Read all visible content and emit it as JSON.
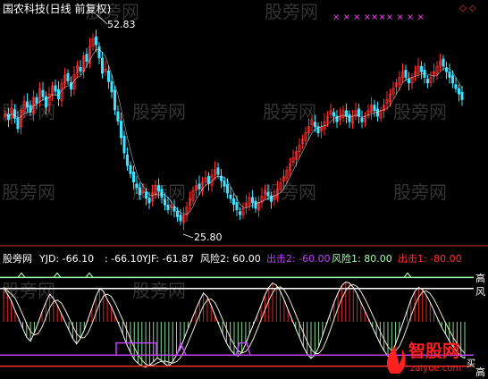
{
  "header": {
    "stock_title": "国农科技(日线 前复权)"
  },
  "price_panel": {
    "high_label": "52.83",
    "low_label": "25.80",
    "top_markers": "× × × ×××× × × ×",
    "right_marker": "◇ ◇",
    "watermarks": [
      "股旁网",
      "股旁网",
      "股旁网",
      "股旁网",
      "股旁网",
      "股旁网",
      "股旁网",
      "股旁网",
      "股旁网",
      "股旁网",
      "股旁网",
      "股旁网"
    ]
  },
  "indicator_panel": {
    "name": "股旁网",
    "legend": [
      {
        "label": "YJD: -66.10",
        "color": "#ffffff"
      },
      {
        "label": ": -66.10",
        "color": "#ffffff"
      },
      {
        "label": "YJF: -61.87",
        "color": "#ffffff"
      },
      {
        "label": "风险2: 60.00",
        "color": "#ffffff"
      },
      {
        "label": "出击2: -60.00",
        "color": "#c040ff"
      },
      {
        "label": "风险1: 80.00",
        "color": "#a0ffb0"
      },
      {
        "label": "出击1: -80.00",
        "color": "#ff3030"
      }
    ],
    "right_labels": [
      "高",
      "风",
      "高"
    ],
    "bottom_right_fragment": "买",
    "watermarks": [
      "股旁网",
      "股旁网",
      "股旁网",
      "股旁网",
      "股旁网"
    ]
  },
  "logo": {
    "text": "智股网",
    "url": "zaiyue.com"
  },
  "colors": {
    "up": "#ff3030",
    "down": "#40e0ff",
    "ma": "#ffffff",
    "risk1": "#a0ffb0",
    "risk2": "#ffffff",
    "attack2": "#c040ff",
    "attack1": "#ff3030",
    "marker": "#ff40ff"
  },
  "chart_data": [
    {
      "type": "candlestick",
      "title": "国农科技(日线 前复权)",
      "price_range": [
        23,
        56
      ],
      "annotations": [
        {
          "text": "52.83",
          "value": 52.83,
          "kind": "high"
        },
        {
          "text": "25.80",
          "value": 25.8,
          "kind": "low"
        }
      ],
      "close": [
        41.6,
        40.8,
        42.5,
        41.0,
        39.5,
        42.2,
        43.4,
        42.6,
        41.9,
        44.0,
        43.2,
        45.3,
        44.1,
        42.6,
        44.5,
        45.7,
        44.9,
        43.8,
        46.0,
        47.2,
        46.4,
        45.2,
        47.3,
        48.6,
        47.8,
        50.0,
        49.2,
        51.4,
        52.5,
        51.6,
        49.7,
        47.5,
        48.1,
        46.3,
        44.8,
        42.2,
        40.6,
        38.2,
        36.0,
        34.2,
        33.0,
        31.8,
        31.0,
        30.0,
        30.6,
        29.5,
        28.8,
        30.2,
        31.3,
        30.5,
        29.6,
        28.5,
        27.8,
        28.5,
        27.6,
        26.8,
        26.2,
        27.0,
        28.2,
        29.4,
        30.6,
        31.3,
        30.8,
        31.8,
        32.4,
        31.6,
        32.8,
        33.6,
        32.9,
        32.0,
        31.2,
        30.2,
        29.4,
        28.6,
        27.8,
        27.1,
        28.0,
        28.8,
        29.6,
        28.8,
        28.0,
        28.9,
        29.8,
        30.6,
        29.8,
        29.0,
        29.9,
        30.8,
        31.7,
        32.6,
        33.5,
        34.4,
        35.3,
        36.2,
        37.1,
        38.0,
        38.9,
        39.8,
        40.7,
        39.8,
        38.9,
        39.7,
        40.5,
        41.3,
        42.1,
        41.3,
        40.5,
        41.3,
        42.1,
        41.3,
        40.5,
        41.3,
        42.1,
        41.3,
        40.5,
        41.3,
        42.1,
        42.9,
        42.1,
        41.3,
        42.1,
        42.9,
        43.7,
        44.5,
        45.3,
        46.1,
        46.9,
        47.7,
        46.9,
        46.1,
        46.9,
        47.7,
        48.5,
        47.7,
        46.9,
        46.1,
        46.9,
        47.7,
        48.5,
        49.3,
        48.5,
        47.7,
        46.9,
        46.1,
        45.3,
        44.5,
        43.7
      ],
      "series": [
        {
          "name": "YJD",
          "last": -66.1
        },
        {
          "name": "YJF",
          "last": -61.87
        }
      ]
    },
    {
      "type": "line",
      "title": "股旁网",
      "ylim": [
        -100,
        100
      ],
      "series": [
        {
          "name": "风险1",
          "values": [
            80
          ],
          "style": "horizontal"
        },
        {
          "name": "风险2",
          "values": [
            60
          ],
          "style": "horizontal"
        },
        {
          "name": "出击2",
          "values": [
            -60
          ],
          "style": "horizontal"
        },
        {
          "name": "出击1",
          "values": [
            -80
          ],
          "style": "horizontal"
        },
        {
          "name": "YJD",
          "last": -66.1
        },
        {
          "name": "YJF",
          "last": -61.87
        }
      ],
      "osc": [
        62,
        50,
        38,
        20,
        5,
        -12,
        -28,
        -35,
        -20,
        -2,
        18,
        35,
        50,
        42,
        30,
        15,
        0,
        -15,
        -30,
        -40,
        -30,
        -15,
        5,
        25,
        45,
        60,
        55,
        40,
        28,
        12,
        -5,
        -22,
        -40,
        -55,
        -68,
        -75,
        -80,
        -82,
        -78,
        -72,
        -65,
        -70,
        -76,
        -80,
        -72,
        -60,
        -48,
        -30,
        -12,
        5,
        22,
        38,
        52,
        45,
        30,
        12,
        -5,
        -22,
        -38,
        -50,
        -58,
        -62,
        -55,
        -40,
        -22,
        -5,
        12,
        30,
        48,
        62,
        70,
        66,
        55,
        40,
        22,
        5,
        -12,
        -28,
        -45,
        -58,
        -66,
        -60,
        -45,
        -25,
        -5,
        15,
        35,
        52,
        65,
        72,
        70,
        62,
        50,
        35,
        20,
        5,
        -10,
        -25,
        -40,
        -52,
        -62,
        -55,
        -40,
        -20,
        0,
        20,
        40,
        55,
        62,
        58,
        48,
        35,
        20,
        5,
        -10,
        -22,
        -35,
        -45,
        -55,
        -62,
        -66
      ]
    }
  ]
}
